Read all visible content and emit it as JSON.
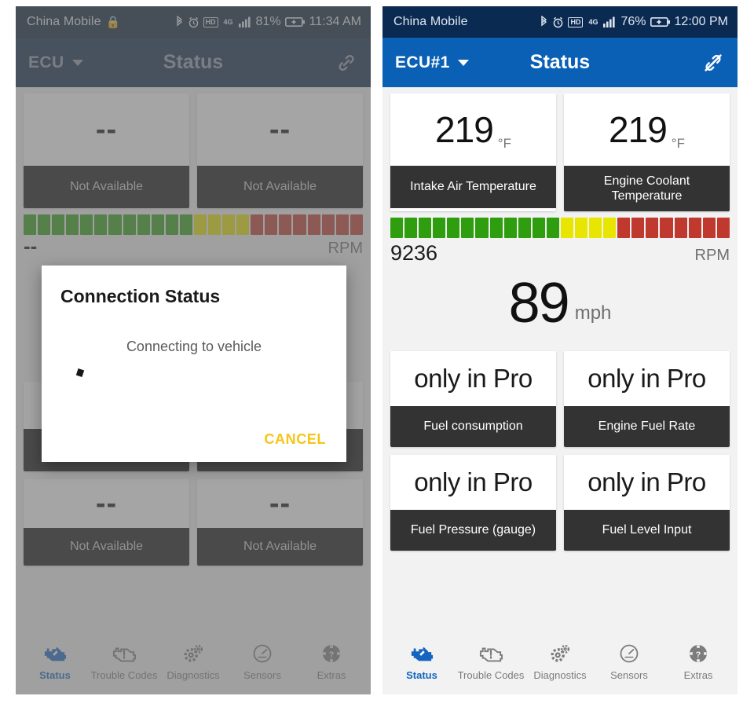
{
  "left_phone": {
    "status_bar": {
      "carrier": "China Mobile",
      "lock_icon": "lock-icon",
      "bluetooth_icon": "bluetooth-icon",
      "alarm_icon": "alarm-icon",
      "hd_badge": "HD",
      "network_badge": "4G",
      "signal_icon": "signal-bars-icon",
      "battery_percent": "81%",
      "battery_icon": "battery-charging-icon",
      "time": "11:34 AM"
    },
    "app_bar": {
      "ecu_label": "ECU",
      "dropdown_icon": "chevron-down-icon",
      "title": "Status",
      "link_icon": "link-icon"
    },
    "cards_top": [
      {
        "value": "--",
        "unit": "",
        "label": "Not Available"
      },
      {
        "value": "--",
        "unit": "",
        "label": "Not Available"
      }
    ],
    "rpm": {
      "value": "--",
      "unit": "RPM",
      "segments": [
        "g",
        "g",
        "g",
        "g",
        "g",
        "g",
        "g",
        "g",
        "g",
        "g",
        "g",
        "g",
        "y",
        "y",
        "y",
        "y",
        "r",
        "r",
        "r",
        "r",
        "r",
        "r",
        "r",
        "r"
      ]
    },
    "cards_bottom": [
      {
        "value": "--",
        "unit": "",
        "label": "Not Available"
      },
      {
        "value": "--",
        "unit": "",
        "label": "Not Available"
      }
    ],
    "bottom_nav": [
      {
        "label": "Status",
        "icon": "engine-check-icon",
        "active": true
      },
      {
        "label": "Trouble Codes",
        "icon": "engine-warning-icon",
        "active": false
      },
      {
        "label": "Diagnostics",
        "icon": "gears-icon",
        "active": false
      },
      {
        "label": "Sensors",
        "icon": "gauge-icon",
        "active": false
      },
      {
        "label": "Extras",
        "icon": "help-ring-icon",
        "active": false
      }
    ]
  },
  "dialog": {
    "title": "Connection Status",
    "message": "Connecting to vehicle",
    "cancel_label": "CANCEL",
    "accent_color": "#f5c518"
  },
  "right_phone": {
    "status_bar": {
      "carrier": "China Mobile",
      "bluetooth_icon": "bluetooth-icon",
      "alarm_icon": "alarm-icon",
      "hd_badge": "HD",
      "network_badge": "4G",
      "signal_icon": "signal-bars-icon",
      "battery_percent": "76%",
      "battery_icon": "battery-charging-icon",
      "time": "12:00 PM"
    },
    "app_bar": {
      "ecu_label": "ECU#1",
      "dropdown_icon": "chevron-down-icon",
      "title": "Status",
      "link_icon": "link-off-icon",
      "accent_color": "#0a60b5"
    },
    "cards_top": [
      {
        "value": "219",
        "unit": "°F",
        "label": "Intake Air Temperature"
      },
      {
        "value": "219",
        "unit": "°F",
        "label": "Engine Coolant Temperature"
      }
    ],
    "rpm": {
      "value": "9236",
      "unit": "RPM",
      "segments": [
        "g",
        "g",
        "g",
        "g",
        "g",
        "g",
        "g",
        "g",
        "g",
        "g",
        "g",
        "g",
        "y",
        "y",
        "y",
        "y",
        "r",
        "r",
        "r",
        "r",
        "r",
        "r",
        "r",
        "r"
      ],
      "green_color": "#2f9e0e",
      "yellow_color": "#e8e500",
      "red_color": "#c0392f"
    },
    "speed": {
      "value": "89",
      "unit": "mph"
    },
    "cards_pro": [
      {
        "value": "only in Pro",
        "label": "Fuel consumption"
      },
      {
        "value": "only in Pro",
        "label": "Engine Fuel Rate"
      },
      {
        "value": "only in Pro",
        "label": "Fuel Pressure (gauge)"
      },
      {
        "value": "only in Pro",
        "label": "Fuel Level Input"
      }
    ],
    "bottom_nav": [
      {
        "label": "Status",
        "icon": "engine-check-icon",
        "active": true
      },
      {
        "label": "Trouble Codes",
        "icon": "engine-warning-icon",
        "active": false
      },
      {
        "label": "Diagnostics",
        "icon": "gears-icon",
        "active": false
      },
      {
        "label": "Sensors",
        "icon": "gauge-icon",
        "active": false
      },
      {
        "label": "Extras",
        "icon": "help-ring-icon",
        "active": false
      }
    ]
  }
}
